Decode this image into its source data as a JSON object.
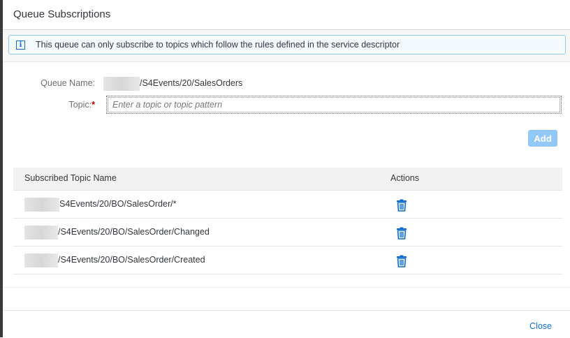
{
  "dialog": {
    "title": "Queue Subscriptions",
    "info_message": "This queue can only subscribe to topics which follow the rules defined in the service descriptor",
    "info_icon": "info-icon"
  },
  "form": {
    "queue_name_label": "Queue Name:",
    "queue_name_value": "/S4Events/20/SalesOrders",
    "topic_label": "Topic:",
    "required_marker": "*",
    "topic_placeholder": "Enter a topic or topic pattern",
    "add_label": "Add"
  },
  "table": {
    "columns": [
      "Subscribed Topic Name",
      "Actions"
    ],
    "rows": [
      {
        "topic": "S4Events/20/BO/SalesOrder/*",
        "action_icon": "trash-icon"
      },
      {
        "topic": "/S4Events/20/BO/SalesOrder/Changed",
        "action_icon": "trash-icon"
      },
      {
        "topic": "/S4Events/20/BO/SalesOrder/Created",
        "action_icon": "trash-icon"
      }
    ]
  },
  "footer": {
    "close_label": "Close"
  },
  "colors": {
    "accent": "#0a6ed1",
    "info_border": "#91c8f6",
    "add_button_disabled": "#91c8f6",
    "required": "#bb0000"
  }
}
